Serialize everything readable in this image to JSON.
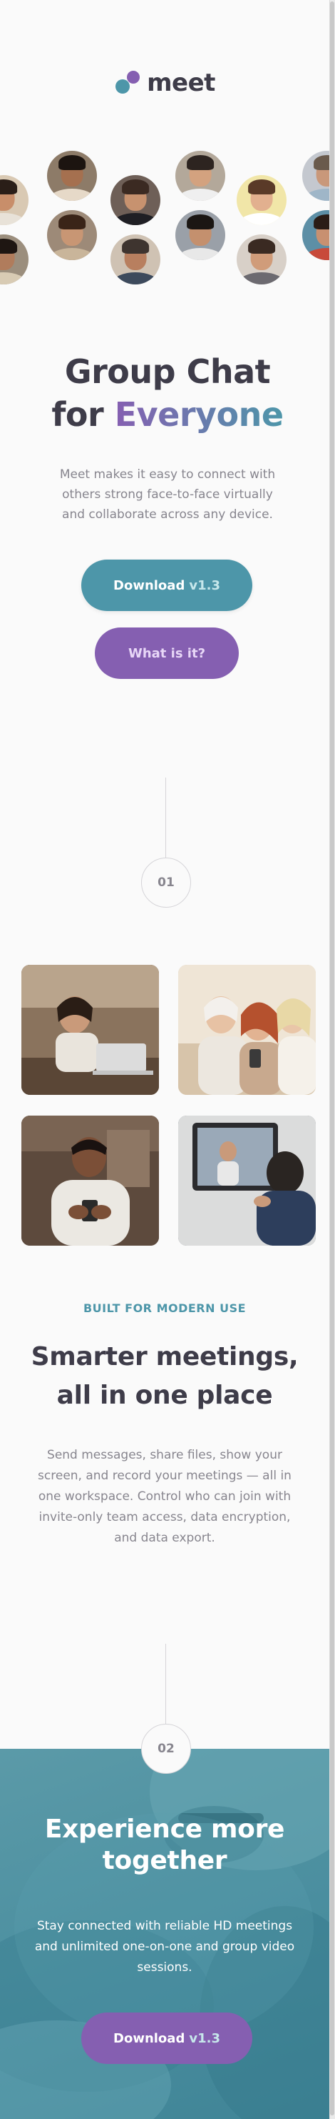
{
  "brand": {
    "name": "meet",
    "colors": {
      "cyan": "#4d96a9",
      "violet": "#855fb1",
      "ink": "#3e3c49",
      "muted": "#87858e"
    }
  },
  "hero": {
    "title_line1": "Group Chat",
    "title_line2_pre": "for ",
    "title_line2_accent": "Everyone",
    "description": "Meet makes it easy to connect with others strong face-to-face virtually and collaborate across any device.",
    "download_label": "Download",
    "download_version": "v1.3",
    "what_label": "What is it?"
  },
  "avatars": [
    {
      "bg": "#d9c9b3",
      "skin": "#c88e6a",
      "hair": "#2a1e18",
      "shirt": "#e8e2d8"
    },
    {
      "bg": "#8d7b68",
      "skin": "#a5704f",
      "hair": "#1c1410",
      "shirt": "#e6d9c8"
    },
    {
      "bg": "#6e5f57",
      "skin": "#c7926f",
      "hair": "#3b2a22",
      "shirt": "#1f1f24"
    },
    {
      "bg": "#b3a89a",
      "skin": "#d3a27f",
      "hair": "#2d2420",
      "shirt": "#efefef"
    },
    {
      "bg": "#f1e6a8",
      "skin": "#e2b08f",
      "hair": "#5a3a28",
      "shirt": "#ffffff"
    },
    {
      "bg": "#c4c8cf",
      "skin": "#c9987a",
      "hair": "#6a5a4c",
      "shirt": "#9fb6c8"
    },
    {
      "bg": "#9b8e7d",
      "skin": "#b07c5c",
      "hair": "#1e1612",
      "shirt": "#d8cbb4"
    },
    {
      "bg": "#9d8a78",
      "skin": "#c89674",
      "hair": "#3a2418",
      "shirt": "#c9b59a"
    },
    {
      "bg": "#cfc2b3",
      "skin": "#b87f5f",
      "hair": "#3e342f",
      "shirt": "#3d4a5c"
    },
    {
      "bg": "#9aa0a8",
      "skin": "#c4906e",
      "hair": "#1b1613",
      "shirt": "#e8e8e8"
    },
    {
      "bg": "#d8d0c8",
      "skin": "#d09c7a",
      "hair": "#3a2a22",
      "shirt": "#6c6a70"
    },
    {
      "bg": "#5d8fa6",
      "skin": "#c89070",
      "hair": "#2a1c16",
      "shirt": "#c84a3a"
    }
  ],
  "steps": {
    "first": "01",
    "second": "02"
  },
  "photos": [
    {
      "bg": "#7a6450",
      "desc": "woman-laptop"
    },
    {
      "bg": "#d9ccb8",
      "desc": "three-women-phone"
    },
    {
      "bg": "#6b5546",
      "desc": "man-phone"
    },
    {
      "bg": "#3a4a5e",
      "desc": "video-call-tablet"
    }
  ],
  "features": {
    "eyebrow": "BUILT FOR MODERN USE",
    "title_line1": "Smarter meetings,",
    "title_line2": "all in one place",
    "description": "Send messages, share files, show your screen, and record your meetings — all in one workspace. Control who can join with invite-only team access, data encryption, and data export."
  },
  "cta": {
    "title_line1": "Experience more",
    "title_line2": "together",
    "description": "Stay connected with reliable HD meetings and unlimited one-on-one and group video sessions.",
    "download_label": "Download",
    "download_version": "v1.3"
  }
}
